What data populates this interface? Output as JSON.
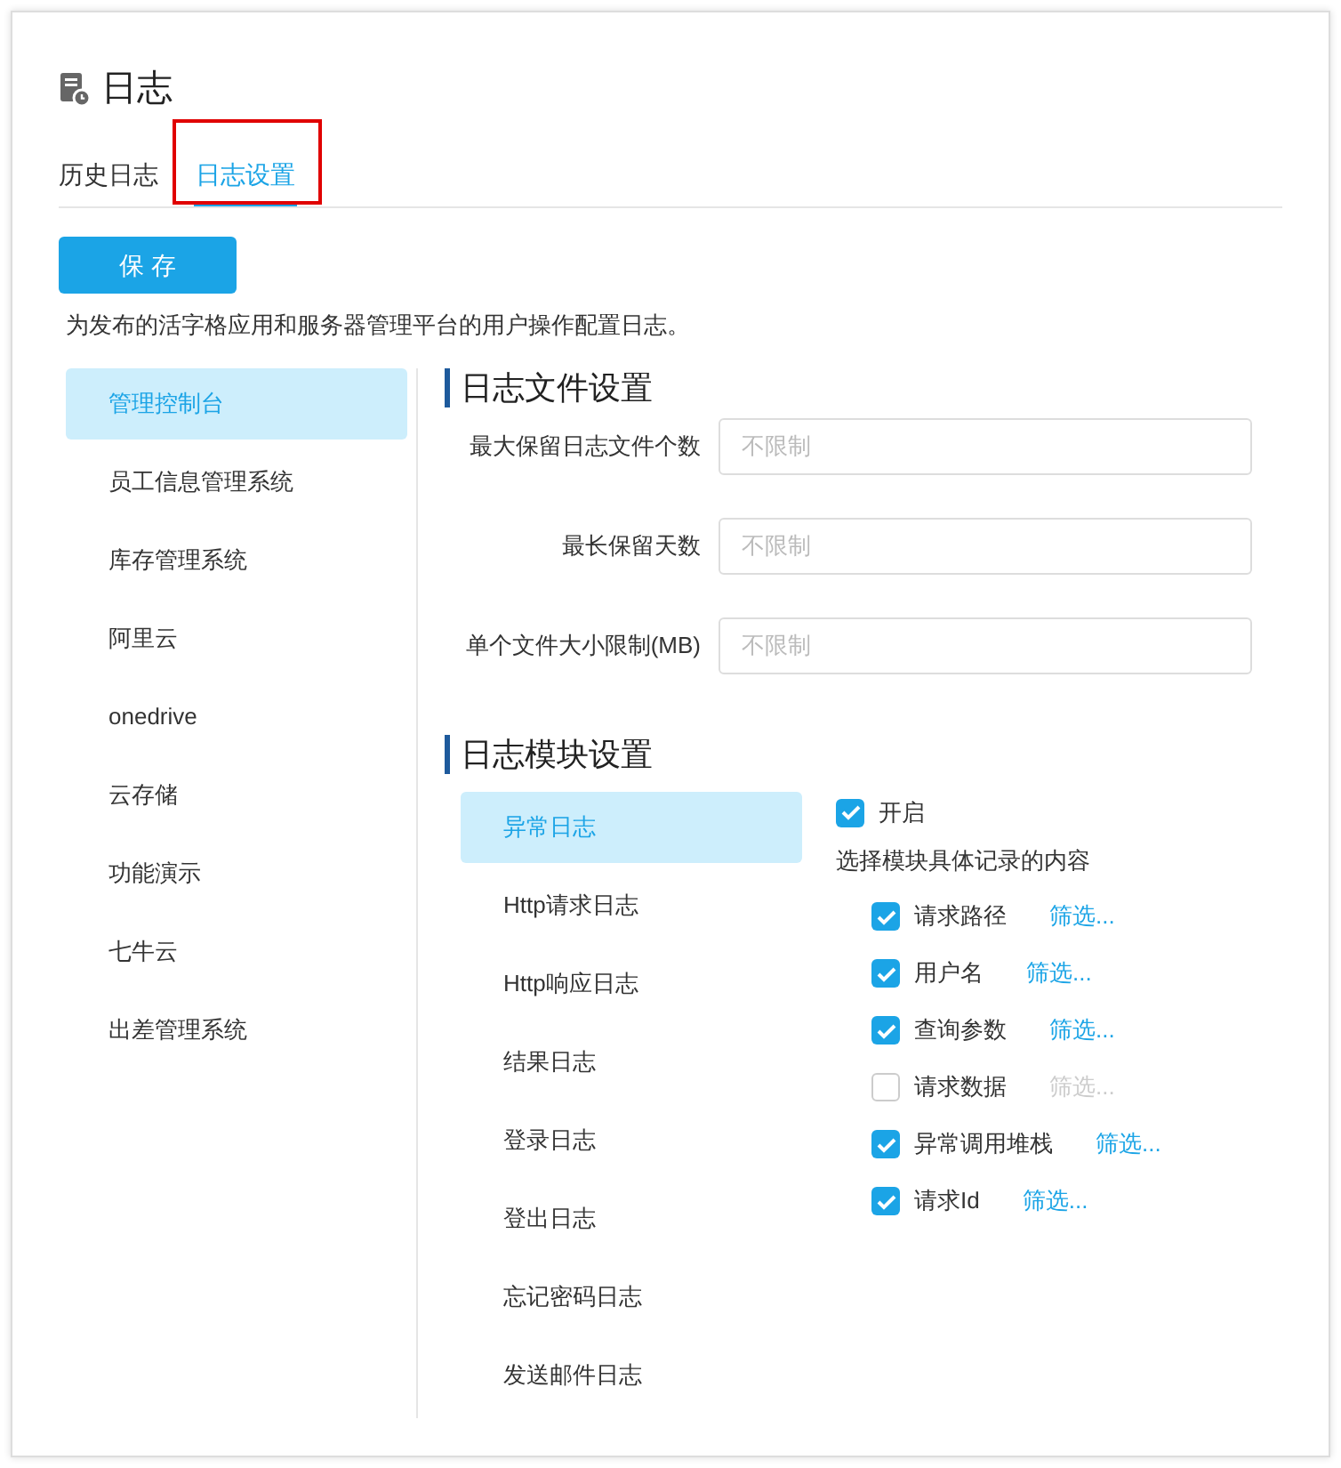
{
  "page": {
    "title": "日志"
  },
  "tabs": [
    {
      "label": "历史日志",
      "selected": false,
      "annotated": false
    },
    {
      "label": "日志设置",
      "selected": true,
      "annotated": true
    }
  ],
  "save_button": "保 存",
  "description": "为发布的活字格应用和服务器管理平台的用户操作配置日志。",
  "sidebar": {
    "items": [
      {
        "label": "管理控制台",
        "selected": true
      },
      {
        "label": "员工信息管理系统",
        "selected": false
      },
      {
        "label": "库存管理系统",
        "selected": false
      },
      {
        "label": "阿里云",
        "selected": false
      },
      {
        "label": "onedrive",
        "selected": false
      },
      {
        "label": "云存储",
        "selected": false
      },
      {
        "label": "功能演示",
        "selected": false
      },
      {
        "label": "七牛云",
        "selected": false
      },
      {
        "label": "出差管理系统",
        "selected": false
      }
    ]
  },
  "file_settings": {
    "heading": "日志文件设置",
    "fields": [
      {
        "label": "最大保留日志文件个数",
        "placeholder": "不限制"
      },
      {
        "label": "最长保留天数",
        "placeholder": "不限制"
      },
      {
        "label": "单个文件大小限制(MB)",
        "placeholder": "不限制"
      }
    ]
  },
  "module_settings": {
    "heading": "日志模块设置",
    "modules": [
      {
        "label": "异常日志",
        "selected": true
      },
      {
        "label": "Http请求日志",
        "selected": false
      },
      {
        "label": "Http响应日志",
        "selected": false
      },
      {
        "label": "结果日志",
        "selected": false
      },
      {
        "label": "登录日志",
        "selected": false
      },
      {
        "label": "登出日志",
        "selected": false
      },
      {
        "label": "忘记密码日志",
        "selected": false
      },
      {
        "label": "发送邮件日志",
        "selected": false
      }
    ],
    "enable": {
      "label": "开启",
      "checked": true
    },
    "content_heading": "选择模块具体记录的内容",
    "contents": [
      {
        "label": "请求路径",
        "checked": true,
        "filter": "筛选..."
      },
      {
        "label": "用户名",
        "checked": true,
        "filter": "筛选..."
      },
      {
        "label": "查询参数",
        "checked": true,
        "filter": "筛选..."
      },
      {
        "label": "请求数据",
        "checked": false,
        "filter": "筛选..."
      },
      {
        "label": "异常调用堆栈",
        "checked": true,
        "filter": "筛选..."
      },
      {
        "label": "请求Id",
        "checked": true,
        "filter": "筛选..."
      }
    ]
  }
}
